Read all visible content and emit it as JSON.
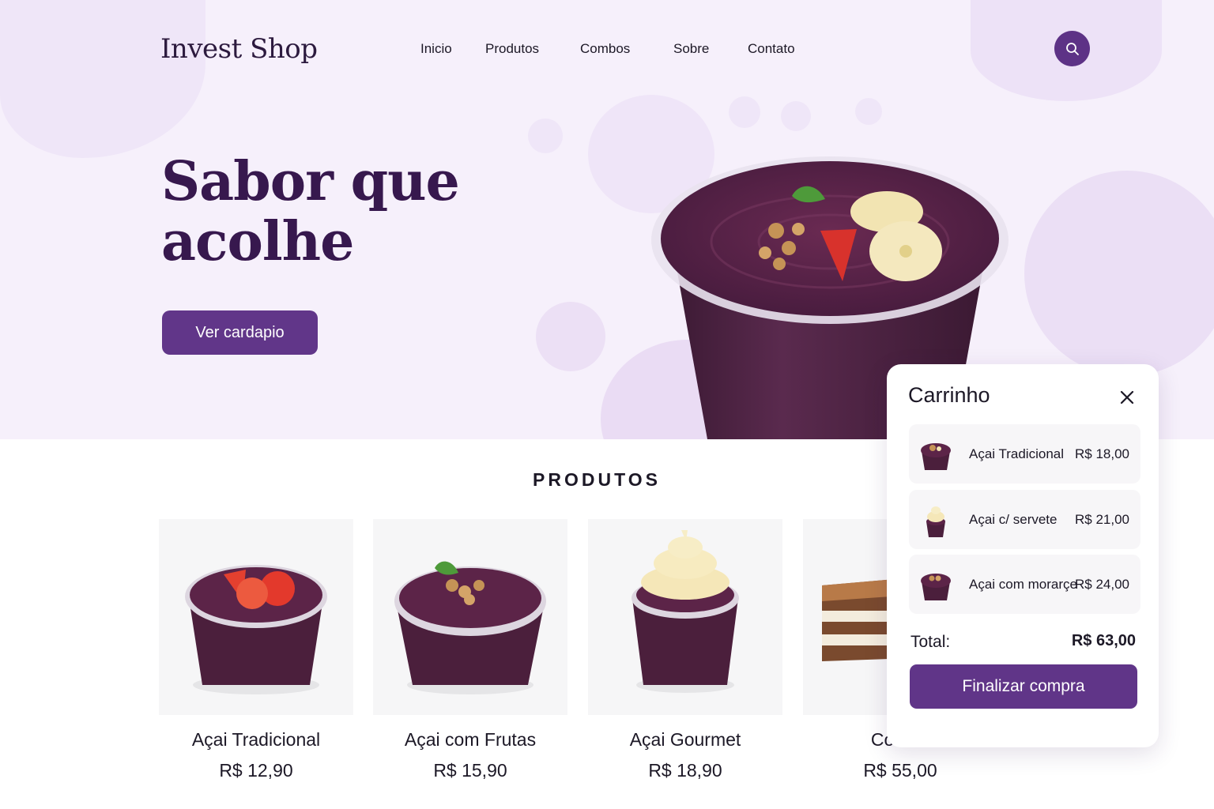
{
  "header": {
    "logo": "Invest Shop",
    "nav": [
      "Inicio",
      "Produtos",
      "Combos",
      "Sobre",
      "Contato"
    ],
    "search_icon": "search-icon"
  },
  "hero": {
    "headline_line1": "Sabor que",
    "headline_line2": "acolhe",
    "cta_label": "Ver cardapio"
  },
  "products": {
    "title": "PRODUTOS",
    "items": [
      {
        "name": "Açai Tradicional",
        "price": "R$ 12,90"
      },
      {
        "name": "Açai com Frutas",
        "price": "R$ 15,90"
      },
      {
        "name": "Açai Gourmet",
        "price": "R$ 18,90"
      },
      {
        "name": "Combo",
        "price": "R$ 55,00"
      }
    ]
  },
  "cart": {
    "title": "Carrinho",
    "items": [
      {
        "name": "Açai Tradicional",
        "price": "R$ 18,00"
      },
      {
        "name": "Açai c/ servete",
        "price": "R$ 21,00"
      },
      {
        "name": "Açai com morarçe",
        "price": "R$ 24,00"
      }
    ],
    "total_label": "Total:",
    "total_value": "R$ 63,00",
    "checkout_label": "Finalizar compra"
  },
  "colors": {
    "brand_purple": "#613689",
    "hero_background": "#f6f0fb",
    "headline": "#37184e"
  }
}
